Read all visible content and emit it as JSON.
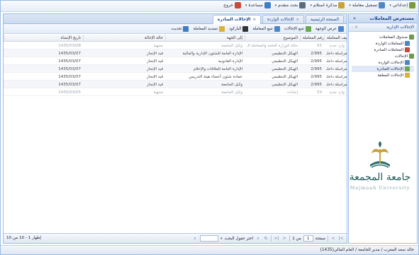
{
  "topmenu": [
    {
      "label": "إعداداتي",
      "icon": "settings-icon",
      "color": "#7c9a3c",
      "caret": true
    },
    {
      "label": "تسجيل معاملة",
      "icon": "register-transaction-icon",
      "color": "#4f86c6",
      "caret": true
    },
    {
      "label": "مذكرة استلام",
      "icon": "receipt-memo-icon",
      "color": "#c9a23a",
      "caret": true
    },
    {
      "label": "بحث متقدم",
      "icon": "advanced-search-icon",
      "color": "#5b6b7e",
      "caret": true
    },
    {
      "label": "مساعدة",
      "icon": "help-icon",
      "color": "#3c7dc4",
      "caret": true
    },
    {
      "label": "خروج",
      "icon": "logout-icon",
      "color": "#c94a3a",
      "caret": false
    }
  ],
  "side": {
    "title": "مستعرض المعاملات",
    "section_title": "الإحالات الإدارية",
    "section_btns": "- ×",
    "tree": [
      {
        "label": "صندوق المعاملات",
        "icon": "inbox-folder-icon",
        "color": "#6b9a4a",
        "level": 0
      },
      {
        "label": "المعاملات الواردة",
        "icon": "incoming-icon",
        "color": "#4b87c8",
        "level": 1
      },
      {
        "label": "المعاملات الصادرة",
        "icon": "outgoing-icon",
        "color": "#c44a3a",
        "level": 1
      },
      {
        "label": "الإحالات",
        "icon": "referrals-folder-icon",
        "color": "#6b9a4a",
        "level": 0
      },
      {
        "label": "الإحالات الواردة",
        "icon": "incoming-referrals-icon",
        "color": "#4b87c8",
        "level": 1
      },
      {
        "label": "الإحالات الصادرة",
        "icon": "outgoing-referrals-icon",
        "color": "#6aa84f",
        "level": 1,
        "selected": true
      },
      {
        "label": "الإحالات المعلقة",
        "icon": "pending-referrals-icon",
        "color": "#d9b23a",
        "level": 1
      }
    ]
  },
  "logo": {
    "ar": "جامعة المجمعة",
    "en": "Majmaah University"
  },
  "tabs": [
    {
      "label": "الصفحة الرئيسية",
      "closable": false,
      "active": false
    },
    {
      "label": "الإحالات الواردة",
      "closable": true,
      "active": false
    },
    {
      "label": "الإحالات الصادرة",
      "closable": true,
      "active": true
    }
  ],
  "toolbar": [
    {
      "label": "عرض الوجهة",
      "icon": "view-destination-icon",
      "color": "#4b87c8"
    },
    {
      "label": "تتبع الإحالات",
      "icon": "track-referrals-icon",
      "color": "#6aa84f"
    },
    {
      "label": "تتبع المعاملة",
      "icon": "track-transaction-icon",
      "color": "#4b87c8"
    },
    {
      "label": "الباركود",
      "icon": "barcode-icon",
      "color": "#333333"
    },
    {
      "label": "تسديد المعاملة",
      "icon": "settle-transaction-icon",
      "color": "#d9b23a"
    },
    {
      "label": "تحديث",
      "icon": "refresh-icon",
      "color": "#3c7dc4"
    }
  ],
  "grid": {
    "columns": [
      "تصنيف المعاملة",
      "رقم المعاملة",
      "الموضوع",
      "إلى الجهة",
      "حالة الإحالة",
      "تاريخ الإنشاء"
    ],
    "rows": [
      [
        "وارد جديد",
        "55",
        "حالة الوزارة العامة والمعاملة الـ...",
        "وكيل الجامعة",
        "منتهية",
        "1435/03/08",
        true
      ],
      [
        "مراسلة داخلـ...",
        "2/995",
        "الهيكل التنظيمي",
        "الإدارة العامة للشئون الإدارية والمالية",
        "قيد الإنجاز",
        "1435/03/07",
        false
      ],
      [
        "مراسلة داخلـ...",
        "2/995",
        "الهيكل التنظيمي",
        "الإدارة القانونية",
        "قيد الإنجاز",
        "1435/03/07",
        false
      ],
      [
        "مراسلة داخلـ...",
        "2/995",
        "الهيكل التنظيمي",
        "الإدارة العامة للعلاقات والإعلام",
        "قيد الإنجاز",
        "1435/03/07",
        false
      ],
      [
        "مراسلة داخلـ...",
        "2/995",
        "الهيكل التنظيمي",
        "عمادة شئون أعضاء هيئة التدريس",
        "قيد الإنجاز",
        "1435/03/07",
        false
      ],
      [
        "مراسلة داخلـ...",
        "2/995",
        "الهيكل التنظيمي",
        "وكيل الجامعة",
        "قيد الإنجاز",
        "1435/03/07",
        false
      ],
      [
        "وارد جديد",
        "59",
        "إجابات",
        "وكيل الجامعة",
        "منتهية",
        "1435/03/05",
        true
      ]
    ]
  },
  "pager": {
    "page_label": "صفحة",
    "page_value": "1",
    "of_label": "من 1",
    "search_label": "اختر حقول البحث",
    "search_value": "",
    "info": "إظهار 1 - 10 من 10"
  },
  "status": "خالد سعد المغرب / مدير الجامعة / العام المالي(1435)"
}
